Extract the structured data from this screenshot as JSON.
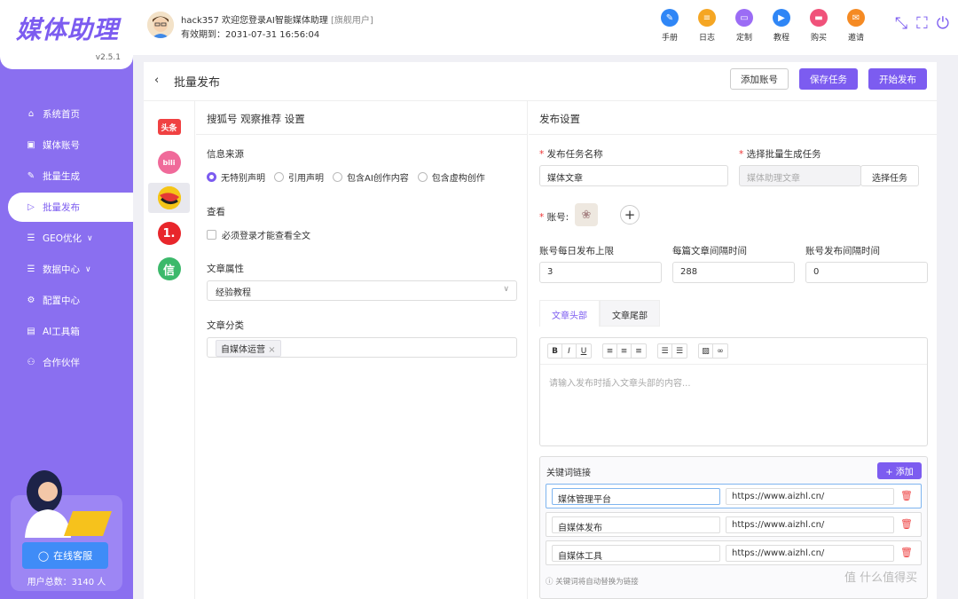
{
  "sidebar": {
    "logo": "媒体助理",
    "version": "v2.5.1",
    "items": [
      {
        "label": "系统首页",
        "icon": "home-icon",
        "glyph": "⌂"
      },
      {
        "label": "媒体账号",
        "icon": "account-icon",
        "glyph": "▣"
      },
      {
        "label": "批量生成",
        "icon": "edit-icon",
        "glyph": "✎"
      },
      {
        "label": "批量发布",
        "icon": "send-icon",
        "glyph": "▷"
      },
      {
        "label": "GEO优化",
        "icon": "list-icon",
        "glyph": "☰"
      },
      {
        "label": "数据中心",
        "icon": "data-icon",
        "glyph": "☰"
      },
      {
        "label": "配置中心",
        "icon": "gear-icon",
        "glyph": "⚙"
      },
      {
        "label": "AI工具箱",
        "icon": "toolbox-icon",
        "glyph": "▤"
      },
      {
        "label": "合作伙伴",
        "icon": "partner-icon",
        "glyph": "⚇"
      }
    ],
    "support_label": "在线客服",
    "user_count": "用户总数：3140 人"
  },
  "header": {
    "username": "hack357",
    "welcome": "欢迎您登录AI智能媒体助理",
    "role": "[旗舰用户]",
    "expiry": "有效期到：2031-07-31 16:56:04",
    "tools": [
      {
        "label": "手册",
        "icon": "manual-icon",
        "color": "#2f86f6",
        "glyph": "✎"
      },
      {
        "label": "日志",
        "icon": "log-icon",
        "color": "#f5a623",
        "glyph": "≡"
      },
      {
        "label": "定制",
        "icon": "customize-icon",
        "color": "#9b6cf5",
        "glyph": "▭"
      },
      {
        "label": "教程",
        "icon": "tutorial-icon",
        "color": "#2f86f6",
        "glyph": "▶"
      },
      {
        "label": "购买",
        "icon": "purchase-icon",
        "color": "#f0527a",
        "glyph": "▬"
      },
      {
        "label": "邀请",
        "icon": "invite-icon",
        "color": "#f58a23",
        "glyph": "✉"
      }
    ]
  },
  "page": {
    "title": "批量发布",
    "add_account": "添加账号",
    "save_task": "保存任务",
    "start_publish": "开始发布"
  },
  "platforms": [
    {
      "name": "头条",
      "icon": "toutiao-icon",
      "color": "#f04142",
      "text": "头条"
    },
    {
      "name": "bilibili",
      "icon": "bilibili-icon",
      "color": "#f06a9a",
      "text": "bili"
    },
    {
      "name": "搜狐号",
      "icon": "sohu-icon",
      "color": "#f5c518",
      "text": ""
    },
    {
      "name": "一点号",
      "icon": "yidian-icon",
      "color": "#e8262b",
      "text": "1."
    },
    {
      "name": "信",
      "icon": "xin-icon",
      "color": "#3cb96b",
      "text": "信"
    }
  ],
  "left": {
    "section_title": "搜狐号 观察推荐 设置",
    "source_label": "信息来源",
    "source_options": [
      "无特别声明",
      "引用声明",
      "包含AI创作内容",
      "包含虚构创作"
    ],
    "view_label": "查看",
    "login_required": "必须登录才能查看全文",
    "attr_label": "文章属性",
    "attr_value": "经验教程",
    "category_label": "文章分类",
    "category_tag": "自媒体运营"
  },
  "right": {
    "section_title": "发布设置",
    "task_name_label": "发布任务名称",
    "task_name_value": "媒体文章",
    "batch_task_label": "选择批量生成任务",
    "batch_task_placeholder": "媒体助理文章",
    "select_task_btn": "选择任务",
    "account_label": "账号:",
    "daily_limit_label": "账号每日发布上限",
    "daily_limit_value": "3",
    "interval_label": "每篇文章间隔时间",
    "interval_value": "288",
    "account_interval_label": "账号发布间隔时间",
    "account_interval_value": "0",
    "tab_head": "文章头部",
    "tab_tail": "文章尾部",
    "editor_placeholder": "请输入发布时插入文章头部的内容...",
    "toolbar": {
      "bold": "B",
      "italic": "I",
      "underline": "U"
    },
    "keyword_title": "关键词链接",
    "keyword_add": "+ 添加",
    "keywords": [
      {
        "word": "媒体管理平台",
        "url": "https://www.aizhl.cn/"
      },
      {
        "word": "自媒体发布",
        "url": "https://www.aizhl.cn/"
      },
      {
        "word": "自媒体工具",
        "url": "https://www.aizhl.cn/"
      }
    ],
    "keyword_note": "ⓘ 关键词将自动替换为链接"
  },
  "watermark": "值 什么值得买"
}
